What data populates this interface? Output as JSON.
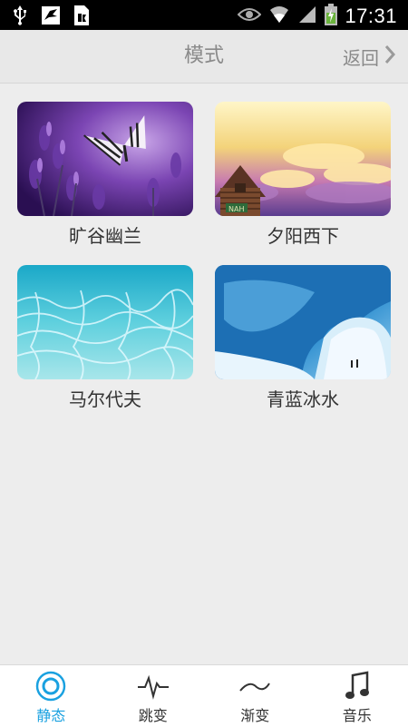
{
  "status_bar": {
    "time": "17:31",
    "left_icons": [
      "usb-icon",
      "bird-app-icon",
      "document-app-icon"
    ],
    "right_icons": [
      "eye-icon",
      "wifi-icon",
      "signal-icon",
      "battery-charging-icon"
    ]
  },
  "header": {
    "title": "模式",
    "back_label": "返回",
    "back_icon": "chevron-right-icon"
  },
  "modes": [
    {
      "label": "旷谷幽兰",
      "image": "butterfly-lavender-image"
    },
    {
      "label": "夕阳西下",
      "image": "sunset-cabin-image"
    },
    {
      "label": "马尔代夫",
      "image": "maldives-water-image"
    },
    {
      "label": "青蓝冰水",
      "image": "ice-cave-image"
    }
  ],
  "tabs": [
    {
      "label": "静态",
      "icon": "static-circle-icon",
      "active": true
    },
    {
      "label": "跳变",
      "icon": "jump-pulse-icon",
      "active": false
    },
    {
      "label": "渐变",
      "icon": "gradient-wave-icon",
      "active": false
    },
    {
      "label": "音乐",
      "icon": "music-note-icon",
      "active": false
    }
  ],
  "colors": {
    "accent": "#1aa1e0",
    "header_text": "#8a8a8a",
    "background": "#ededed"
  }
}
